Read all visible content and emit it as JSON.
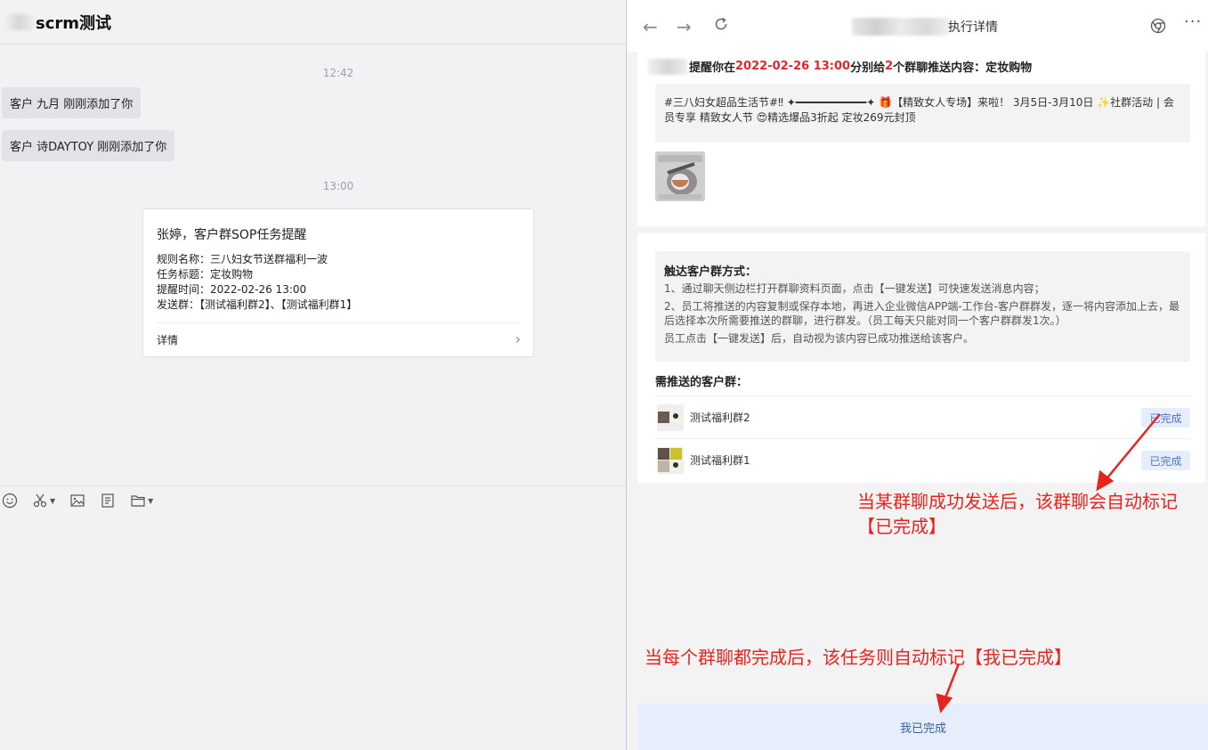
{
  "chat": {
    "title": "scrm测试",
    "time1": "12:42",
    "system_messages": [
      "客户 九月 刚刚添加了你",
      "客户 诗DAYTOY 刚刚添加了你"
    ],
    "time2": "13:00",
    "card": {
      "title": "张婷，客户群SOP任务提醒",
      "rule_name": "规则名称：三八妇女节送群福利一波",
      "task_title": "任务标题：定妆购物",
      "remind_time": "提醒时间：2022-02-26 13:00",
      "send_groups": "发送群：【测试福利群2】、【测试福利群1】",
      "detail_label": "详情"
    },
    "toolbar_icons": [
      "emoji-icon",
      "scissors-icon",
      "image-icon",
      "document-icon",
      "folder-icon"
    ]
  },
  "detail": {
    "nav_title": "执行详情",
    "remind": {
      "prefix": "提醒你在 ",
      "datetime": "2022-02-26 13:00",
      "mid": " 分别给",
      "count": "2",
      "suffix": "个群聊推送内容：定妆购物"
    },
    "message_text": "#三八妇女超品生活节#‼ ✦━━━━━━━━━━━✦ 🎁【精致女人专场】来啦！ 3月5日-3月10日 ✨社群活动 | 会员专享 精致女人节 😍精选爆品3折起 定妆269元封顶",
    "method": {
      "title": "触达客户群方式：",
      "line1": "1、通过聊天侧边栏打开群聊资料页面，点击【一键发送】可快速发送消息内容；",
      "line2": "2、员工将推送的内容复制或保存本地，再进入企业微信APP端-工作台-客户群群发，逐一将内容添加上去，最后选择本次所需要推送的群聊，进行群发。（员工每天只能对同一个客户群群发1次。）",
      "line3": "员工点击【一键发送】后，自动视为该内容已成功推送给该客户。"
    },
    "need_title": "需推送的客户群：",
    "groups": [
      {
        "name": "测试福利群2",
        "status": "已完成"
      },
      {
        "name": "测试福利群1",
        "status": "已完成"
      }
    ],
    "done_button": "我已完成"
  },
  "annotations": {
    "note1": "当某群聊成功发送后，该群聊会自动标记【已完成】",
    "note2": "当每个群聊都完成后，该任务则自动标记【我已完成】"
  },
  "colors": {
    "accent_red": "#e0262d",
    "annotation_red": "#e8231f",
    "badge_blue": "#4f72c9",
    "badge_bg": "#e7eefb"
  }
}
